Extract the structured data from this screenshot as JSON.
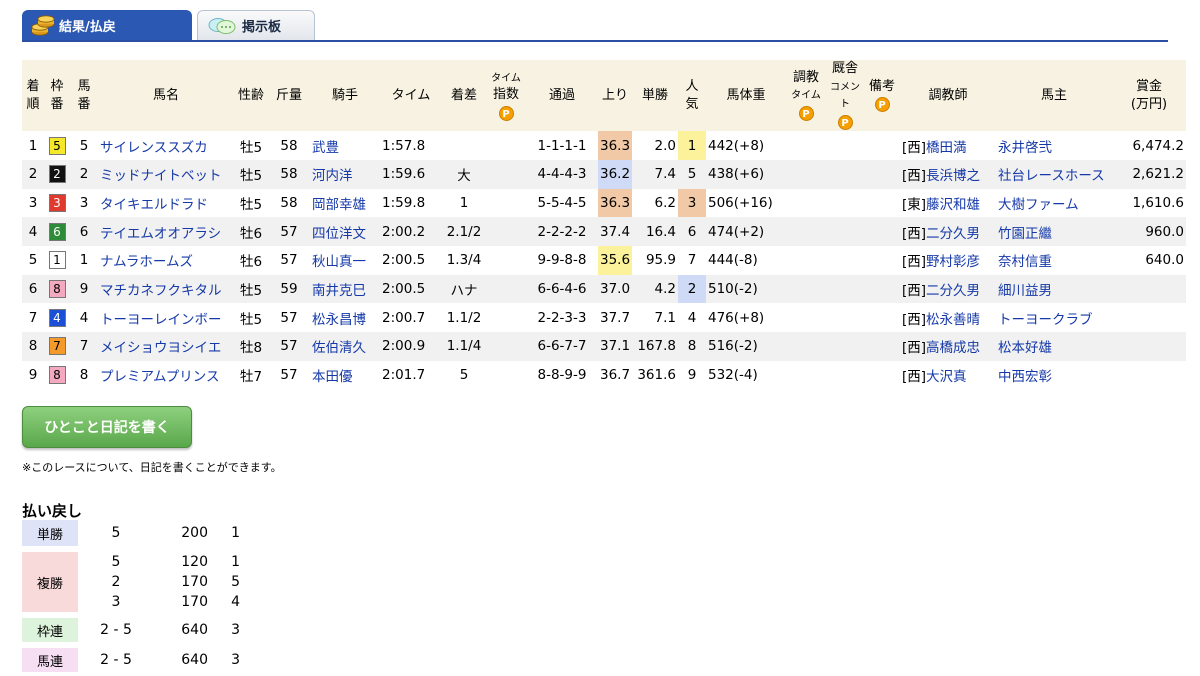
{
  "tabs": [
    {
      "label": "結果/払戻",
      "active": true,
      "icon": "coins-icon"
    },
    {
      "label": "掲示板",
      "active": false,
      "icon": "speech-bubble-icon"
    }
  ],
  "headers": {
    "chakujun": [
      "着",
      "順"
    ],
    "waku": [
      "枠",
      "番"
    ],
    "umaban": [
      "馬",
      "番"
    ],
    "name": "馬名",
    "sexage": "性齢",
    "kinryo": "斤量",
    "jockey": "騎手",
    "time": "タイム",
    "margin": "着差",
    "time_index": [
      "タイム",
      "指数"
    ],
    "passing": "通過",
    "agari": "上り",
    "odds": "単勝",
    "ninki": [
      "人",
      "気"
    ],
    "weight": "馬体重",
    "chokyo": [
      "調教",
      "タイム"
    ],
    "kyusha": [
      "厩舎",
      "コメント"
    ],
    "biko": "備考",
    "trainer": "調教師",
    "owner": "馬主",
    "prize": [
      "賞金",
      "(万円)"
    ],
    "p_mark": "P"
  },
  "rows": [
    {
      "rank": "1",
      "waku": "5",
      "umaban": "5",
      "name": "サイレンススズカ",
      "sexage": "牡5",
      "kinryo": "58",
      "jockey": "武豊",
      "time": "1:57.8",
      "margin": "",
      "passing": "1-1-1-1",
      "agari": "36.3",
      "odds": "2.0",
      "ninki": "1",
      "weight": "442(+8)",
      "region": "[西]",
      "trainer": "橋田満",
      "owner": "永井啓弐",
      "prize": "6,474.2"
    },
    {
      "rank": "2",
      "waku": "2",
      "umaban": "2",
      "name": "ミッドナイトベット",
      "sexage": "牡5",
      "kinryo": "58",
      "jockey": "河内洋",
      "time": "1:59.6",
      "margin": "大",
      "passing": "4-4-4-3",
      "agari": "36.2",
      "odds": "7.4",
      "ninki": "5",
      "weight": "438(+6)",
      "region": "[西]",
      "trainer": "長浜博之",
      "owner": "社台レースホース",
      "prize": "2,621.2"
    },
    {
      "rank": "3",
      "waku": "3",
      "umaban": "3",
      "name": "タイキエルドラド",
      "sexage": "牡5",
      "kinryo": "58",
      "jockey": "岡部幸雄",
      "time": "1:59.8",
      "margin": "1",
      "passing": "5-5-4-5",
      "agari": "36.3",
      "odds": "6.2",
      "ninki": "3",
      "weight": "506(+16)",
      "region": "[東]",
      "trainer": "藤沢和雄",
      "owner": "大樹ファーム",
      "prize": "1,610.6"
    },
    {
      "rank": "4",
      "waku": "6",
      "umaban": "6",
      "name": "テイエムオオアラシ",
      "sexage": "牡6",
      "kinryo": "57",
      "jockey": "四位洋文",
      "time": "2:00.2",
      "margin": "2.1/2",
      "passing": "2-2-2-2",
      "agari": "37.4",
      "odds": "16.4",
      "ninki": "6",
      "weight": "474(+2)",
      "region": "[西]",
      "trainer": "二分久男",
      "owner": "竹園正繼",
      "prize": "960.0"
    },
    {
      "rank": "5",
      "waku": "1",
      "umaban": "1",
      "name": "ナムラホームズ",
      "sexage": "牡6",
      "kinryo": "57",
      "jockey": "秋山真一",
      "time": "2:00.5",
      "margin": "1.3/4",
      "passing": "9-9-8-8",
      "agari": "35.6",
      "odds": "95.9",
      "ninki": "7",
      "weight": "444(-8)",
      "region": "[西]",
      "trainer": "野村彰彦",
      "owner": "奈村信重",
      "prize": "640.0"
    },
    {
      "rank": "6",
      "waku": "8",
      "umaban": "9",
      "name": "マチカネフクキタル",
      "sexage": "牡5",
      "kinryo": "59",
      "jockey": "南井克巳",
      "time": "2:00.5",
      "margin": "ハナ",
      "passing": "6-6-4-6",
      "agari": "37.0",
      "odds": "4.2",
      "ninki": "2",
      "weight": "510(-2)",
      "region": "[西]",
      "trainer": "二分久男",
      "owner": "細川益男",
      "prize": ""
    },
    {
      "rank": "7",
      "waku": "4",
      "umaban": "4",
      "name": "トーヨーレインボー",
      "sexage": "牡5",
      "kinryo": "57",
      "jockey": "松永昌博",
      "time": "2:00.7",
      "margin": "1.1/2",
      "passing": "2-2-3-3",
      "agari": "37.7",
      "odds": "7.1",
      "ninki": "4",
      "weight": "476(+8)",
      "region": "[西]",
      "trainer": "松永善晴",
      "owner": "トーヨークラブ",
      "prize": ""
    },
    {
      "rank": "8",
      "waku": "7",
      "umaban": "7",
      "name": "メイショウヨシイエ",
      "sexage": "牡8",
      "kinryo": "57",
      "jockey": "佐伯清久",
      "time": "2:00.9",
      "margin": "1.1/4",
      "passing": "6-6-7-7",
      "agari": "37.1",
      "odds": "167.8",
      "ninki": "8",
      "weight": "516(-2)",
      "region": "[西]",
      "trainer": "高橋成忠",
      "owner": "松本好雄",
      "prize": ""
    },
    {
      "rank": "9",
      "waku": "8",
      "umaban": "8",
      "name": "プレミアムプリンス",
      "sexage": "牡7",
      "kinryo": "57",
      "jockey": "本田優",
      "time": "2:01.7",
      "margin": "5",
      "passing": "8-8-9-9",
      "agari": "36.7",
      "odds": "361.6",
      "ninki": "9",
      "weight": "532(-4)",
      "region": "[西]",
      "trainer": "大沢真",
      "owner": "中西宏彰",
      "prize": ""
    }
  ],
  "waku_colors": {
    "1": {
      "bg": "#ffffff",
      "fg": "#000000"
    },
    "2": {
      "bg": "#111111",
      "fg": "#ffffff"
    },
    "3": {
      "bg": "#e03a2f",
      "fg": "#ffffff"
    },
    "4": {
      "bg": "#1c4fd6",
      "fg": "#ffffff"
    },
    "5": {
      "bg": "#f5e82a",
      "fg": "#000000"
    },
    "6": {
      "bg": "#2e8b3a",
      "fg": "#ffffff"
    },
    "7": {
      "bg": "#f39a2b",
      "fg": "#000000"
    },
    "8": {
      "bg": "#f4a9c0",
      "fg": "#000000"
    }
  },
  "diary_button": "ひとこと日記を書く",
  "diary_note": "※このレースについて、日記を書くことができます。",
  "payout": {
    "title": "払い戻し",
    "tansho": {
      "label": "単勝",
      "rows": [
        {
          "num": "5",
          "amount": "200",
          "pop": "1"
        }
      ]
    },
    "fukusho": {
      "label": "複勝",
      "rows": [
        {
          "num": "5",
          "amount": "120",
          "pop": "1"
        },
        {
          "num": "2",
          "amount": "170",
          "pop": "5"
        },
        {
          "num": "3",
          "amount": "170",
          "pop": "4"
        }
      ]
    },
    "wakuren": {
      "label": "枠連",
      "rows": [
        {
          "num": "2 - 5",
          "amount": "640",
          "pop": "3"
        }
      ]
    },
    "umaren": {
      "label": "馬連",
      "rows": [
        {
          "num": "2 - 5",
          "amount": "640",
          "pop": "3"
        }
      ]
    }
  }
}
